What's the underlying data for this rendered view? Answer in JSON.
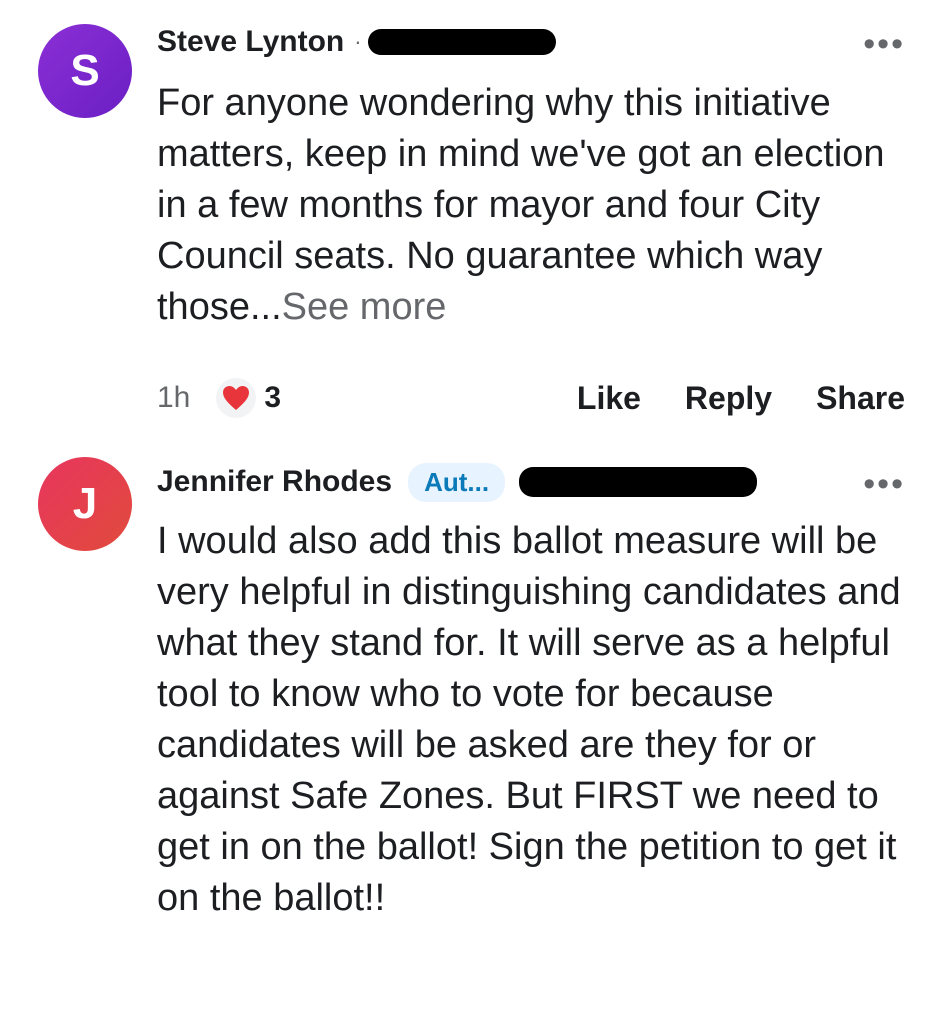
{
  "comments": [
    {
      "avatar_letter": "S",
      "author": "Steve Lynton",
      "separator": "·",
      "more_glyph": "•••",
      "body": "For anyone wondering why this initiative matters, keep in mind we've got an election in a few months for mayor and four City Council seats. No guarantee which way those...",
      "see_more": "See more",
      "time": "1h",
      "reaction_icon": "heart-icon",
      "reaction_count": "3",
      "actions": {
        "like": "Like",
        "reply": "Reply",
        "share": "Share"
      }
    },
    {
      "avatar_letter": "J",
      "author": "Jennifer Rhodes",
      "badge": "Aut...",
      "more_glyph": "•••",
      "body": "I would also add this ballot measure will be very helpful in distinguishing candidates and what they stand for. It will serve as a helpful tool to know who to vote for because candidates will be asked are they for or against Safe Zones. But FIRST we need to get in on the ballot! Sign the petition to get it on the ballot!!"
    }
  ],
  "colors": {
    "avatar_s": "#7b27d0",
    "avatar_j": "#e5404d",
    "badge_bg": "#e7f3ff",
    "badge_text": "#0a7ab8",
    "heart": "#e8353b"
  }
}
